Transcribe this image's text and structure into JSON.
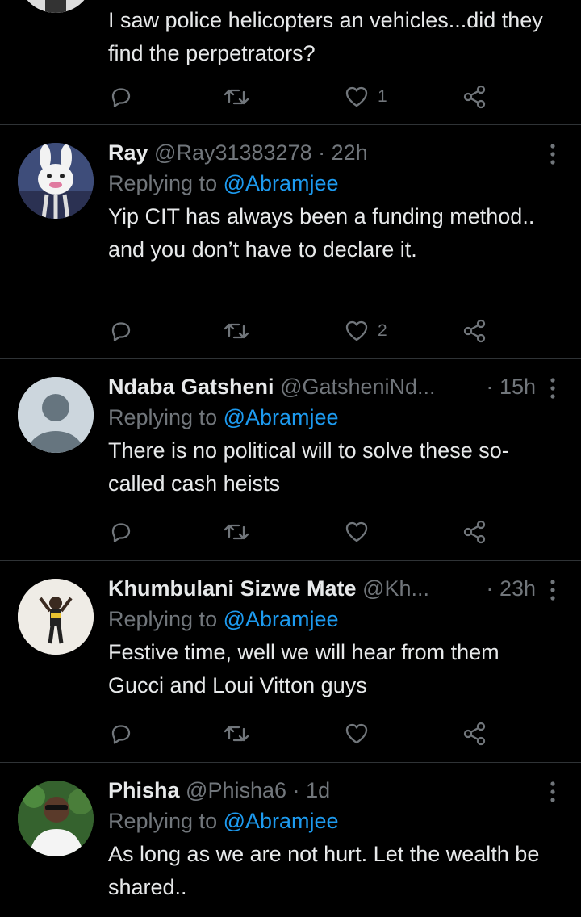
{
  "colors": {
    "background": "#000000",
    "text": "#e7e9ea",
    "muted": "#71767b",
    "accent": "#1d9bf0",
    "divider": "#2f3336"
  },
  "tweets": [
    {
      "name": "",
      "handle": "",
      "time": "",
      "replying_prefix": "",
      "replying_to": "",
      "text": "I saw police helicopters an vehicles...did they find the perpetrators?",
      "likes": "1"
    },
    {
      "name": "Ray",
      "handle": "@Ray31383278",
      "time": "22h",
      "replying_prefix": "Replying to",
      "replying_to": "@Abramjee",
      "text": "Yip CIT has always been a funding method.. and you don’t have to declare it.",
      "likes": "2"
    },
    {
      "name": "Ndaba Gatsheni",
      "handle": "@GatsheniNd...",
      "time": "15h",
      "replying_prefix": "Replying to",
      "replying_to": "@Abramjee",
      "text": "There is no political will to solve these so-called cash heists",
      "likes": ""
    },
    {
      "name": "Khumbulani Sizwe Mate",
      "handle": "@Kh...",
      "time": "23h",
      "replying_prefix": "Replying to",
      "replying_to": "@Abramjee",
      "text": "Festive time, well we will hear from them Gucci and Loui Vitton guys",
      "likes": ""
    },
    {
      "name": "Phisha",
      "handle": "@Phisha6",
      "time": "1d",
      "replying_prefix": "Replying to",
      "replying_to": "@Abramjee",
      "text": "As long as we are not hurt. Let the wealth be shared..",
      "likes": ""
    }
  ],
  "icons": {
    "reply": "reply-icon",
    "retweet": "retweet-icon",
    "like": "heart-icon",
    "share": "share-icon",
    "more": "more-vertical-icon"
  }
}
